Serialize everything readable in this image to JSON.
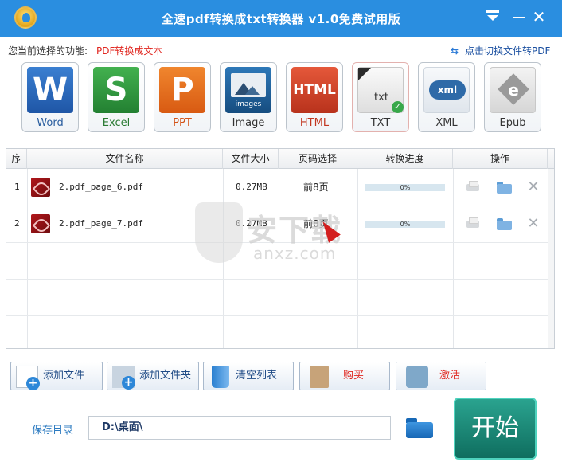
{
  "titlebar": {
    "title": "全速pdf转换成txt转换器 v1.0免费试用版",
    "close_glyph": "✕"
  },
  "function": {
    "label": "您当前选择的功能:",
    "value": "PDF转换成文本",
    "switch_label": "点击切换文件转PDF"
  },
  "formats": [
    {
      "label": "Word",
      "glyph": "W",
      "color": "#2a67bd"
    },
    {
      "label": "Excel",
      "glyph": "S",
      "color": "#2e9a3e"
    },
    {
      "label": "PPT",
      "glyph": "P",
      "color": "#e86a1d"
    },
    {
      "label": "Image",
      "glyph": "images",
      "color": "#1f5f94"
    },
    {
      "label": "HTML",
      "glyph": "HTML",
      "color": "#d4452a"
    },
    {
      "label": "TXT",
      "glyph": "txt",
      "color": "#e9e9e9"
    },
    {
      "label": "XML",
      "glyph": "xml",
      "color": "#e9edf2"
    },
    {
      "label": "Epub",
      "glyph": "e",
      "color": "#a9a9a9"
    }
  ],
  "table": {
    "headers": [
      "序",
      "文件名称",
      "文件大小",
      "页码选择",
      "转换进度",
      "操作"
    ],
    "rows": [
      {
        "index": "1",
        "name": "2.pdf_page_6.pdf",
        "size": "0.27MB",
        "pages": "前8页",
        "progress": "0%"
      },
      {
        "index": "2",
        "name": "2.pdf_page_7.pdf",
        "size": "0.27MB",
        "pages": "前8页",
        "progress": "0%"
      }
    ]
  },
  "buttons": {
    "add_file": "添加文件",
    "add_folder": "添加文件夹",
    "clear_list": "清空列表",
    "buy": "购买",
    "activate": "激活"
  },
  "save": {
    "label": "保存目录",
    "path": "D:\\桌面\\"
  },
  "start_label": "开始",
  "watermark": {
    "text": "安下载",
    "sub": "anxz.com"
  }
}
